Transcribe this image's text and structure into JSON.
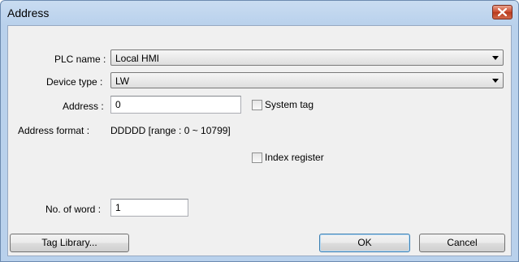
{
  "window": {
    "title": "Address"
  },
  "form": {
    "plc_name": {
      "label": "PLC name :",
      "value": "Local HMI"
    },
    "device_type": {
      "label": "Device type :",
      "value": "LW"
    },
    "address": {
      "label": "Address :",
      "value": "0"
    },
    "system_tag": {
      "label": "System tag",
      "checked": false
    },
    "address_format": {
      "label": "Address format :",
      "value": "DDDDD [range : 0 ~ 10799]"
    },
    "index_register": {
      "label": "Index register",
      "checked": false
    },
    "no_of_word": {
      "label": "No. of word :",
      "value": "1"
    }
  },
  "buttons": {
    "tag_library": "Tag Library...",
    "ok": "OK",
    "cancel": "Cancel"
  },
  "colors": {
    "titlebar": "#b9d1ec",
    "client": "#f0f0f0",
    "close": "#c8472b"
  }
}
